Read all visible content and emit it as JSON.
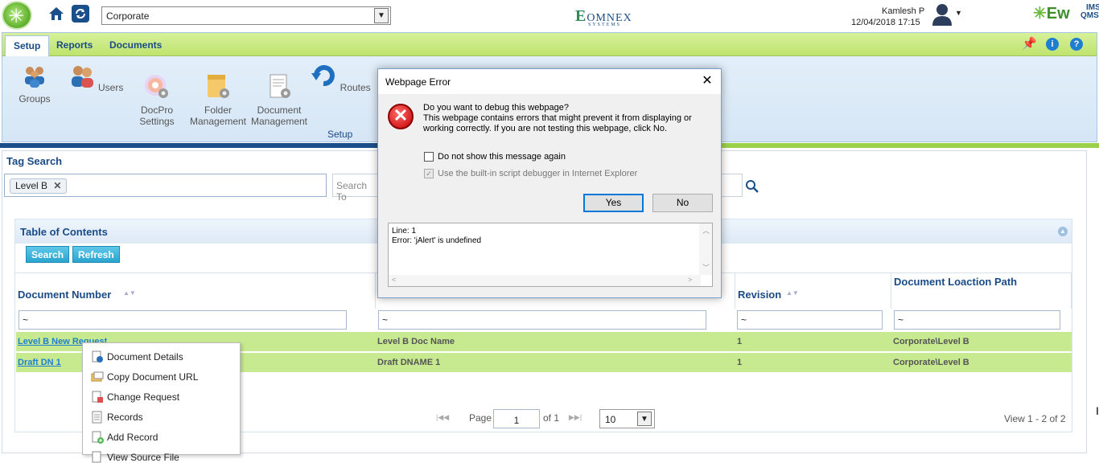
{
  "header": {
    "org_select": "Corporate",
    "omnex_logo": "OMNEX",
    "omnex_sub": "SYSTEMS",
    "user_name": "Kamlesh P",
    "date_time": "12/04/2018 17:15",
    "brand": "Ew",
    "brand_sub_top": "IMS",
    "brand_sub_bottom": "QMS"
  },
  "ribbon": {
    "tabs": [
      "Setup",
      "Reports",
      "Documents"
    ],
    "tools": [
      {
        "label": "Groups",
        "icon": "groups-icon"
      },
      {
        "label": "Users",
        "icon": "users-icon"
      },
      {
        "label": "DocPro\nSettings",
        "icon": "docpro-settings-icon"
      },
      {
        "label": "Folder\nManagement",
        "icon": "folder-management-icon"
      },
      {
        "label": "Document\nManagement",
        "icon": "document-management-icon"
      },
      {
        "label": "Routes",
        "icon": "routes-icon"
      }
    ],
    "group_label": "Setup"
  },
  "tag_search": {
    "title": "Tag Search",
    "chip": "Level B",
    "search_placeholder": "Search To"
  },
  "toc": {
    "title": "Table of Contents",
    "search_button": "Search",
    "refresh_button": "Refresh",
    "columns": [
      "Document Number",
      "Revision",
      "Document Loaction Path"
    ],
    "filter_value": "~",
    "rows": [
      {
        "number": "Level B New Request",
        "name": "Level B Doc Name",
        "revision": "1",
        "path": "Corporate\\Level B"
      },
      {
        "number": "Draft DN 1",
        "name": "Draft DNAME 1",
        "revision": "1",
        "path": "Corporate\\Level B"
      }
    ],
    "pager": {
      "page_label": "Page",
      "page_value": "1",
      "of_label": "of 1",
      "page_size": "10",
      "view_label": "View 1 - 2 of 2"
    }
  },
  "context_menu": {
    "items": [
      {
        "label": "Document Details",
        "icon": "document-details-icon"
      },
      {
        "label": "Copy Document URL",
        "icon": "copy-url-icon"
      },
      {
        "label": "Change Request",
        "icon": "change-request-icon"
      },
      {
        "label": "Records",
        "icon": "records-icon"
      },
      {
        "label": "Add Record",
        "icon": "add-record-icon"
      },
      {
        "label": "View Source File",
        "icon": "view-source-icon"
      }
    ]
  },
  "dialog": {
    "title": "Webpage Error",
    "question": "Do you want to debug this webpage?",
    "message": "This webpage contains errors that might prevent it from displaying or working correctly. If you are not testing this webpage, click No.",
    "checkbox_1": "Do not show this message again",
    "checkbox_2": "Use the built-in script debugger in Internet Explorer",
    "yes_button": "Yes",
    "no_button": "No",
    "error_line": "Line: 1",
    "error_text": "Error: 'jAlert' is undefined"
  }
}
